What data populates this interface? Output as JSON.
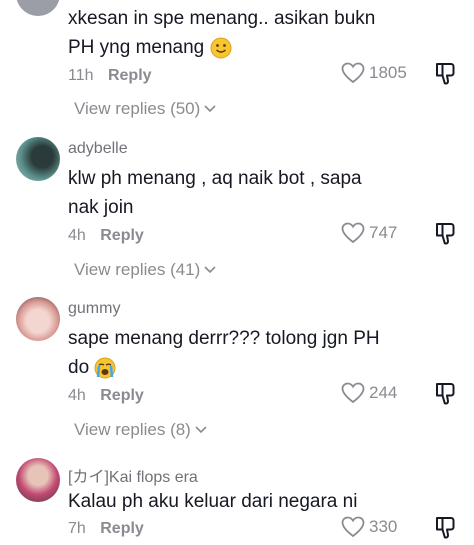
{
  "comments": [
    {
      "username": "",
      "lines": [
        "xkesan in spe menang.. asikan bukn",
        "PH yng menang"
      ],
      "emoji_line2": "slight-smile-emoji",
      "time": "11h",
      "reply_label": "Reply",
      "likes": "1805",
      "view_replies": "View replies (50)"
    },
    {
      "username": "adybelle",
      "lines": [
        "klw ph menang , aq naik bot , sapa",
        "nak join"
      ],
      "time": "4h",
      "reply_label": "Reply",
      "likes": "747",
      "view_replies": "View replies (41)"
    },
    {
      "username": "gummy",
      "lines": [
        "sape menang derrr??? tolong jgn PH",
        "do"
      ],
      "emoji_line2": "crying-emoji",
      "time": "4h",
      "reply_label": "Reply",
      "likes": "244",
      "view_replies": "View replies (8)"
    },
    {
      "username": "[カイ]Kai flops era",
      "lines": [
        "Kalau ph aku keluar dari negara ni"
      ],
      "time": "7h",
      "reply_label": "Reply",
      "likes": "330"
    }
  ],
  "colors": {
    "text": "#161823",
    "muted": "#8a8b91",
    "username": "#6f7278"
  }
}
